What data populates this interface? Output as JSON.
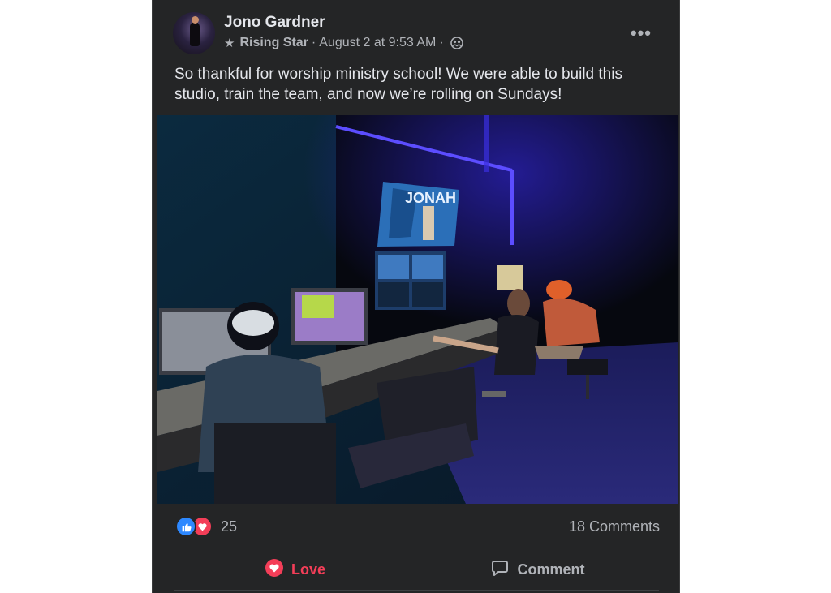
{
  "post": {
    "author": "Jono Gardner",
    "badge": "Rising Star",
    "separator": "·",
    "timestamp": "August 2 at 9:53 AM",
    "more": "•••",
    "text": "So thankful for worship ministry school! We were able to build this studio, train the team, and now we’re rolling on Sundays!",
    "photo_screen_text": "JONAH"
  },
  "reactions": {
    "count": "25",
    "types": [
      "like",
      "love"
    ],
    "colors": {
      "like": "#2d88ff",
      "love": "#f33e58"
    }
  },
  "comments_count": "18 Comments",
  "actions": {
    "love_label": "Love",
    "comment_label": "Comment"
  },
  "icons": {
    "badge": "star-icon",
    "audience": "group-icon",
    "love": "heart-icon",
    "comment": "speech-bubble-icon"
  }
}
